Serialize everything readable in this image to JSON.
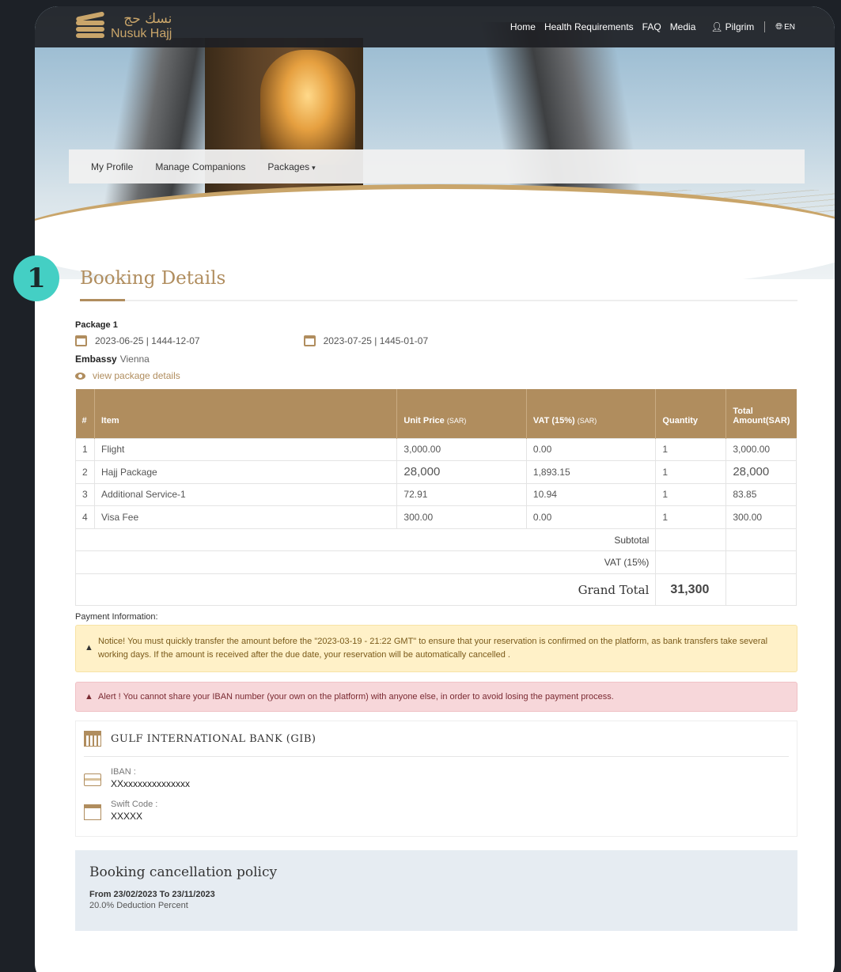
{
  "header": {
    "logo_ar": "نسك حج",
    "logo_en": "Nusuk Hajj",
    "nav": [
      "Home",
      "Health Requirements",
      "FAQ",
      "Media"
    ],
    "user": "Pilgrim",
    "lang": "EN"
  },
  "subnav": {
    "items": [
      "My Profile",
      "Manage Companions",
      "Packages"
    ]
  },
  "step_number": "1",
  "page": {
    "title": "Booking Details",
    "package_label": "Package 1",
    "start_date": "2023-06-25 | 1444-12-07",
    "end_date": "2023-07-25 | 1445-01-07",
    "embassy_label": "Embassy",
    "embassy_value": "Vienna",
    "view_details": "view package details"
  },
  "table": {
    "headers": {
      "num": "#",
      "item": "Item",
      "unit_price": "Unit Price",
      "unit_price_unit": "(SAR)",
      "vat": "VAT (15%)",
      "vat_unit": "(SAR)",
      "quantity": "Quantity",
      "total": "Total",
      "total_unit": "Amount(SAR)"
    },
    "rows": [
      {
        "num": "1",
        "item": "Flight",
        "unit_price": "3,000.00",
        "vat": "0.00",
        "qty": "1",
        "total": "3,000.00"
      },
      {
        "num": "2",
        "item": "Hajj Package",
        "unit_price": "28,000",
        "vat": "1,893.15",
        "qty": "1",
        "total": "28,000"
      },
      {
        "num": "3",
        "item": "Additional Service-1",
        "unit_price": "72.91",
        "vat": "10.94",
        "qty": "1",
        "total": "83.85"
      },
      {
        "num": "4",
        "item": "Visa Fee",
        "unit_price": "300.00",
        "vat": "0.00",
        "qty": "1",
        "total": "300.00"
      }
    ],
    "subtotal_label": "Subtotal",
    "vat_label": "VAT (15%)",
    "grand_total_label": "Grand Total",
    "grand_total_value": "31,300"
  },
  "payment": {
    "title": "Payment Information:",
    "notice": "Notice! You must quickly transfer the amount before the \"2023-03-19 - 21:22 GMT\" to ensure that your reservation is confirmed on the platform, as bank transfers take several working days. If the amount is received after the due date, your reservation will be automatically cancelled .",
    "alert": "Alert ! You cannot share your IBAN number (your own on the platform) with anyone else, in order to avoid losing the payment process.",
    "bank_name": "GULF INTERNATIONAL BANK (GIB)",
    "iban_label": "IBAN :",
    "iban_value": "XXxxxxxxxxxxxxxx",
    "swift_label": "Swift Code :",
    "swift_value": "XXXXX"
  },
  "policy": {
    "title": "Booking cancellation policy",
    "range": "From 23/02/2023 To 23/11/2023",
    "deduction": "20.0% Deduction Percent"
  }
}
